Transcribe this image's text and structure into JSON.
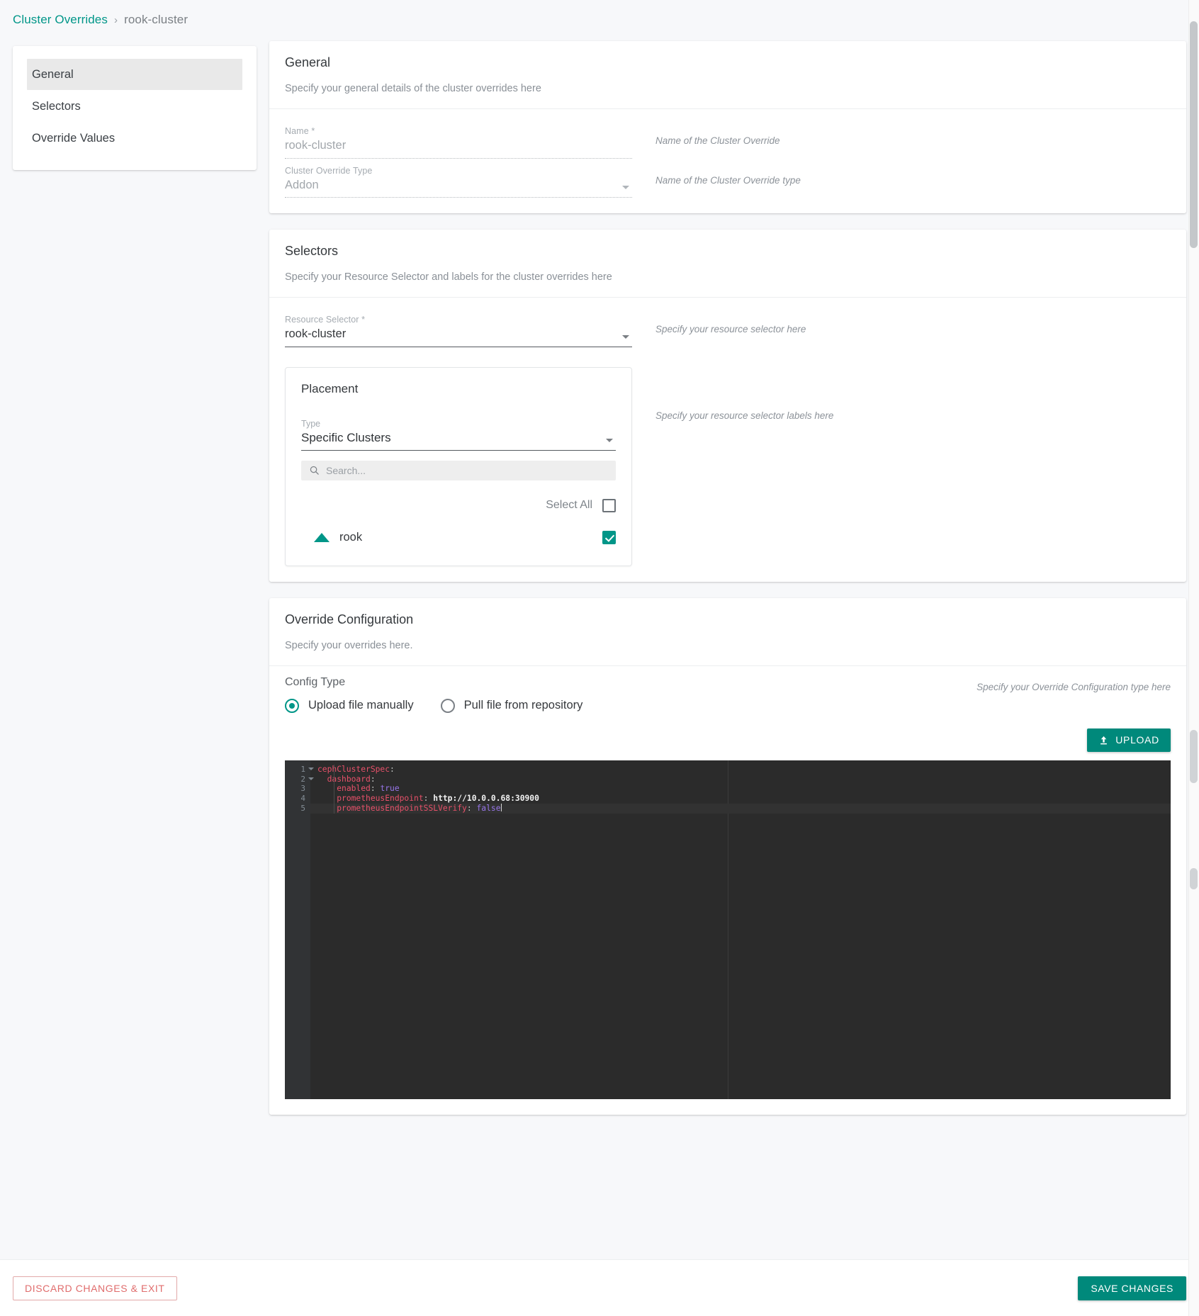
{
  "breadcrumb": {
    "root": "Cluster Overrides",
    "separator": "›",
    "current": "rook-cluster"
  },
  "sidebar": {
    "items": [
      {
        "label": "General",
        "active": true
      },
      {
        "label": "Selectors",
        "active": false
      },
      {
        "label": "Override Values",
        "active": false
      }
    ]
  },
  "general": {
    "title": "General",
    "subtitle": "Specify your general details of the cluster overrides here",
    "name_label": "Name *",
    "name_value": "rook-cluster",
    "name_hint": "Name of the Cluster Override",
    "type_label": "Cluster Override Type",
    "type_value": "Addon",
    "type_hint": "Name of the Cluster Override type"
  },
  "selectors": {
    "title": "Selectors",
    "subtitle": "Specify your Resource Selector and labels for the cluster overrides here",
    "resource_selector_label": "Resource Selector *",
    "resource_selector_value": "rook-cluster",
    "resource_selector_hint": "Specify your resource selector here",
    "labels_hint": "Specify your resource selector labels here",
    "placement": {
      "title": "Placement",
      "type_label": "Type",
      "type_value": "Specific Clusters",
      "search_placeholder": "Search...",
      "search_value": "",
      "select_all_label": "Select All",
      "select_all_checked": false,
      "clusters": [
        {
          "name": "rook",
          "checked": true
        }
      ]
    }
  },
  "override_configuration": {
    "title": "Override Configuration",
    "subtitle": "Specify your overrides here.",
    "config_type_label": "Config Type",
    "config_type_hint": "Specify your Override Configuration type here",
    "options": [
      {
        "label": "Upload file manually",
        "selected": true
      },
      {
        "label": "Pull file from repository",
        "selected": false
      }
    ],
    "upload_button": "UPLOAD",
    "editor": {
      "line_numbers": [
        "1",
        "2",
        "3",
        "4",
        "5"
      ],
      "lines": [
        {
          "indent": 0,
          "key": "cephClusterSpec",
          "colon": ":",
          "value": "",
          "value_kind": "none",
          "foldable": true
        },
        {
          "indent": 1,
          "key": "dashboard",
          "colon": ":",
          "value": "",
          "value_kind": "none",
          "foldable": true
        },
        {
          "indent": 2,
          "key": "enabled",
          "colon": ":",
          "value": "true",
          "value_kind": "bool",
          "foldable": false
        },
        {
          "indent": 2,
          "key": "prometheusEndpoint",
          "colon": ":",
          "value": "http://10.0.0.68:30900",
          "value_kind": "url",
          "foldable": false
        },
        {
          "indent": 2,
          "key": "prometheusEndpointSSLVerify",
          "colon": ":",
          "value": "false",
          "value_kind": "bool",
          "foldable": false
        }
      ],
      "active_line": 5
    }
  },
  "footer": {
    "discard_label": "DISCARD CHANGES & EXIT",
    "save_label": "SAVE CHANGES"
  },
  "colors": {
    "accent": "#009688",
    "accent_button": "#00897b",
    "danger": "#e06c6c",
    "page_bg": "#f7f8fa"
  }
}
